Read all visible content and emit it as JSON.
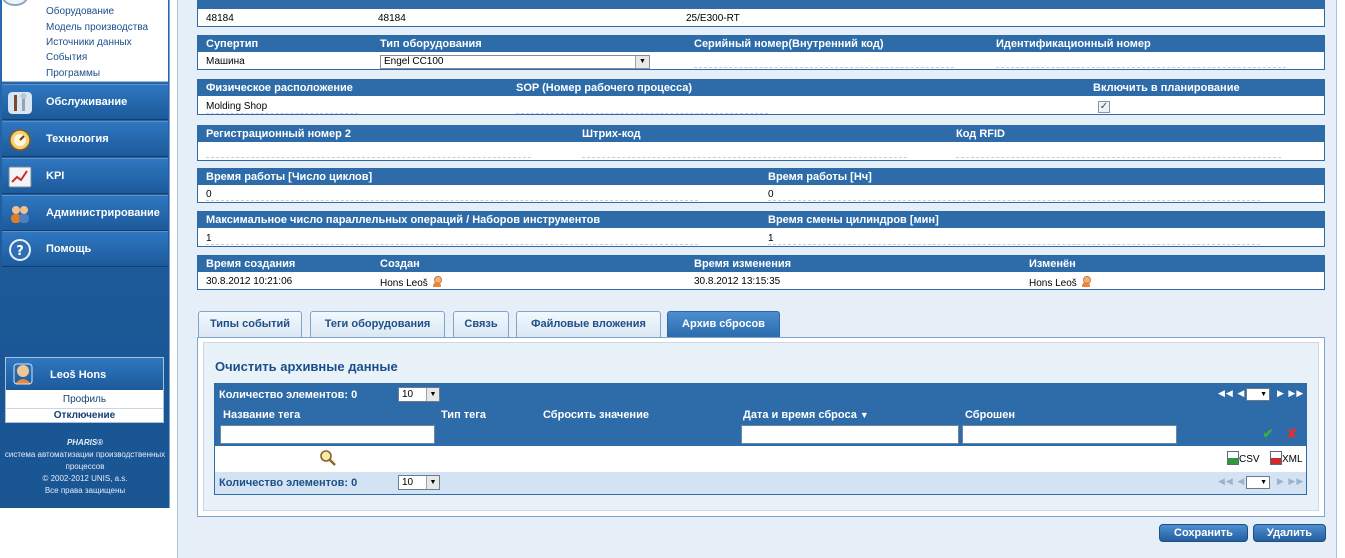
{
  "sidebar": {
    "sub_items": [
      "Оборудование",
      "Модель производства",
      "Источники данных",
      "События",
      "Программы"
    ],
    "menu": [
      {
        "label": "Обслуживание",
        "icon": "tools-icon"
      },
      {
        "label": "Технология",
        "icon": "gauge-icon"
      },
      {
        "label": "KPI",
        "icon": "chart-icon"
      },
      {
        "label": "Администрирование",
        "icon": "users-icon"
      },
      {
        "label": "Помощь",
        "icon": "help-icon"
      }
    ],
    "user": {
      "name": "Leoš Hons",
      "profile": "Профиль",
      "logout": "Отключение"
    },
    "brand": {
      "name": "PHARIS®",
      "line1": "система автоматизации производственных",
      "line2": "процессов",
      "copyright": "© 2002-2012 UNIS, a.s.",
      "rights": "Все права защищены"
    }
  },
  "top_row": {
    "v1": "48184",
    "v2": "48184",
    "v3": "25/E300-RT"
  },
  "row_type": {
    "labels": {
      "supertype": "Супертип",
      "equip_type": "Тип оборудования",
      "serial": "Серийный номер(Внутренний код)",
      "ident": "Идентификационный номер"
    },
    "values": {
      "supertype": "Машина",
      "equip_type": "Engel CC100"
    }
  },
  "row_location": {
    "labels": {
      "location": "Физическое расположение",
      "sop": "SOP (Номер рабочего процесса)",
      "planning": "Включить в планирование"
    },
    "values": {
      "location": "Molding Shop"
    },
    "planning_checked": true
  },
  "row_reg": {
    "labels": {
      "reg": "Регистрационный номер 2",
      "barcode": "Штрих-код",
      "rfid": "Код RFID"
    }
  },
  "row_work": {
    "labels": {
      "cycles": "Время работы [Число циклов]",
      "hours": "Время работы [Нч]"
    },
    "values": {
      "cycles": "0",
      "hours": "0"
    }
  },
  "row_max": {
    "labels": {
      "max_ops": "Максимальное число параллельных операций / Наборов инструментов",
      "cyl": "Время смены цилиндров [мин]"
    },
    "values": {
      "max_ops": "1",
      "cyl": "1"
    }
  },
  "row_audit": {
    "labels": {
      "created_time": "Время создания",
      "created_by": "Создан",
      "modified_time": "Время изменения",
      "modified_by": "Изменён"
    },
    "values": {
      "created_time": "30.8.2012 10:21:06",
      "created_by": "Hons Leoš",
      "modified_time": "30.8.2012 13:15:35",
      "modified_by": "Hons Leoš"
    }
  },
  "tabs": [
    {
      "label": "Типы событий",
      "active": false
    },
    {
      "label": "Теги оборудования",
      "active": false
    },
    {
      "label": "Связь",
      "active": false
    },
    {
      "label": "Файловые вложения",
      "active": false
    },
    {
      "label": "Архив сбросов",
      "active": true
    }
  ],
  "archive": {
    "title": "Очистить архивные данные",
    "count_label": "Количество элементов: 0",
    "page_size": "10",
    "columns": [
      "Название тега",
      "Тип тега",
      "Сбросить значение",
      "Дата и время сброса",
      "Сброшен"
    ],
    "sort_indicator": "▼",
    "export": {
      "csv": "CSV",
      "xml": "XML"
    }
  },
  "actions": {
    "save": "Сохранить",
    "delete": "Удалить"
  },
  "colors": {
    "header_blue": "#2e6ca9",
    "sidebar_blue": "#1c5a9b",
    "panel_bg": "#e6eff8"
  }
}
